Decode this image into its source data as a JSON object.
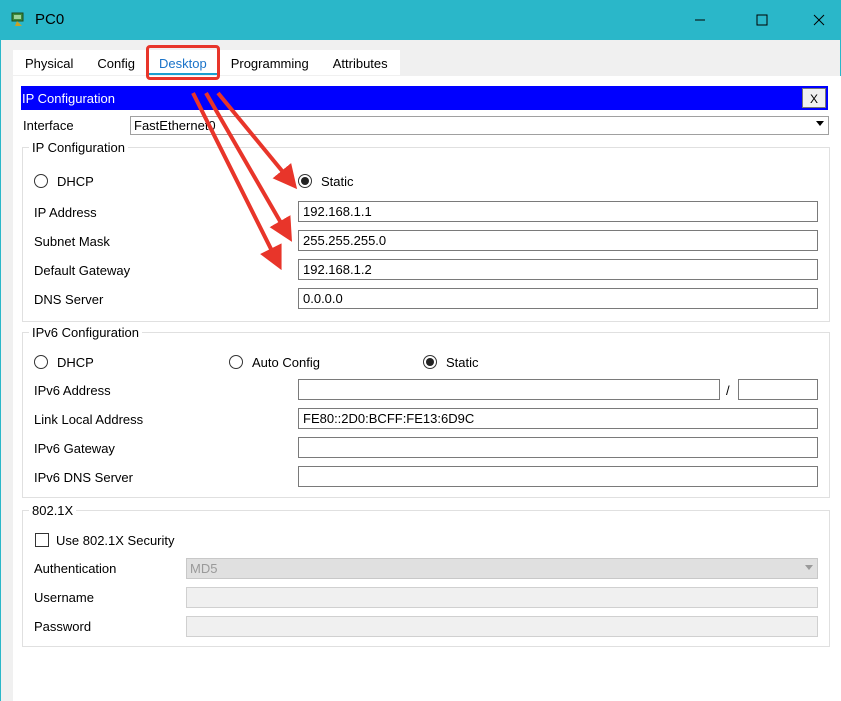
{
  "window": {
    "title": "PC0",
    "minimize_icon": "minimize-icon",
    "maximize_icon": "maximize-icon",
    "close_icon": "close-icon"
  },
  "tabs": [
    "Physical",
    "Config",
    "Desktop",
    "Programming",
    "Attributes"
  ],
  "active_tab": "Desktop",
  "dialog": {
    "header": "IP Configuration",
    "close_label": "X"
  },
  "interface": {
    "label": "Interface",
    "value": "FastEthernet0"
  },
  "ipv4": {
    "legend": "IP Configuration",
    "dhcp_label": "DHCP",
    "static_label": "Static",
    "mode": "Static",
    "ip_label": "IP Address",
    "ip_value": "192.168.1.1",
    "mask_label": "Subnet Mask",
    "mask_value": "255.255.255.0",
    "gw_label": "Default Gateway",
    "gw_value": "192.168.1.2",
    "dns_label": "DNS Server",
    "dns_value": "0.0.0.0"
  },
  "ipv6": {
    "legend": "IPv6 Configuration",
    "dhcp_label": "DHCP",
    "auto_label": "Auto Config",
    "static_label": "Static",
    "mode": "Static",
    "addr_label": "IPv6 Address",
    "addr_value": "",
    "prefix_sep": "/",
    "prefix_value": "",
    "link_local_label": "Link Local Address",
    "link_local_value": "FE80::2D0:BCFF:FE13:6D9C",
    "gw_label": "IPv6 Gateway",
    "gw_value": "",
    "dns_label": "IPv6 DNS Server",
    "dns_value": ""
  },
  "dot1x": {
    "legend": "802.1X",
    "use_label": "Use 802.1X Security",
    "use_checked": false,
    "auth_label": "Authentication",
    "auth_value": "MD5",
    "user_label": "Username",
    "user_value": "",
    "pass_label": "Password",
    "pass_value": ""
  },
  "colors": {
    "titlebar": "#2ab7c9",
    "header": "#0000ff",
    "annotation": "#e8352a"
  }
}
